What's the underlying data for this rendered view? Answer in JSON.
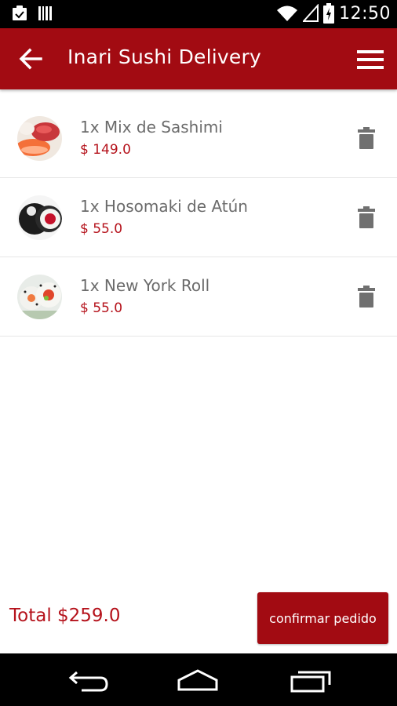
{
  "status_bar": {
    "time": "12:50",
    "icons": [
      "clipboard-icon",
      "barcode-icon",
      "wifi-icon",
      "signal-icon",
      "battery-icon"
    ]
  },
  "app_bar": {
    "title": "Inari Sushi Delivery",
    "back_icon": "arrow-back-icon",
    "menu_icon": "menu-icon",
    "color": "#a20b12"
  },
  "cart": {
    "items": [
      {
        "name": "1x Mix de Sashimi",
        "price": "$ 149.0",
        "image": "sashimi-image"
      },
      {
        "name": "1x Hosomaki de Atún",
        "price": "$ 55.0",
        "image": "hosomaki-image"
      },
      {
        "name": "1x New York Roll",
        "price": "$ 55.0",
        "image": "new-york-roll-image"
      }
    ],
    "delete_icon": "trash-icon"
  },
  "footer": {
    "total": "Total $259.0",
    "confirm_label": "confirmar pedido"
  },
  "nav_bar": {
    "icons": [
      "nav-back-icon",
      "nav-home-icon",
      "nav-recents-icon"
    ]
  },
  "colors": {
    "primary": "#a20b12",
    "price_text": "#b5121b",
    "item_text": "#6b6b6b"
  }
}
